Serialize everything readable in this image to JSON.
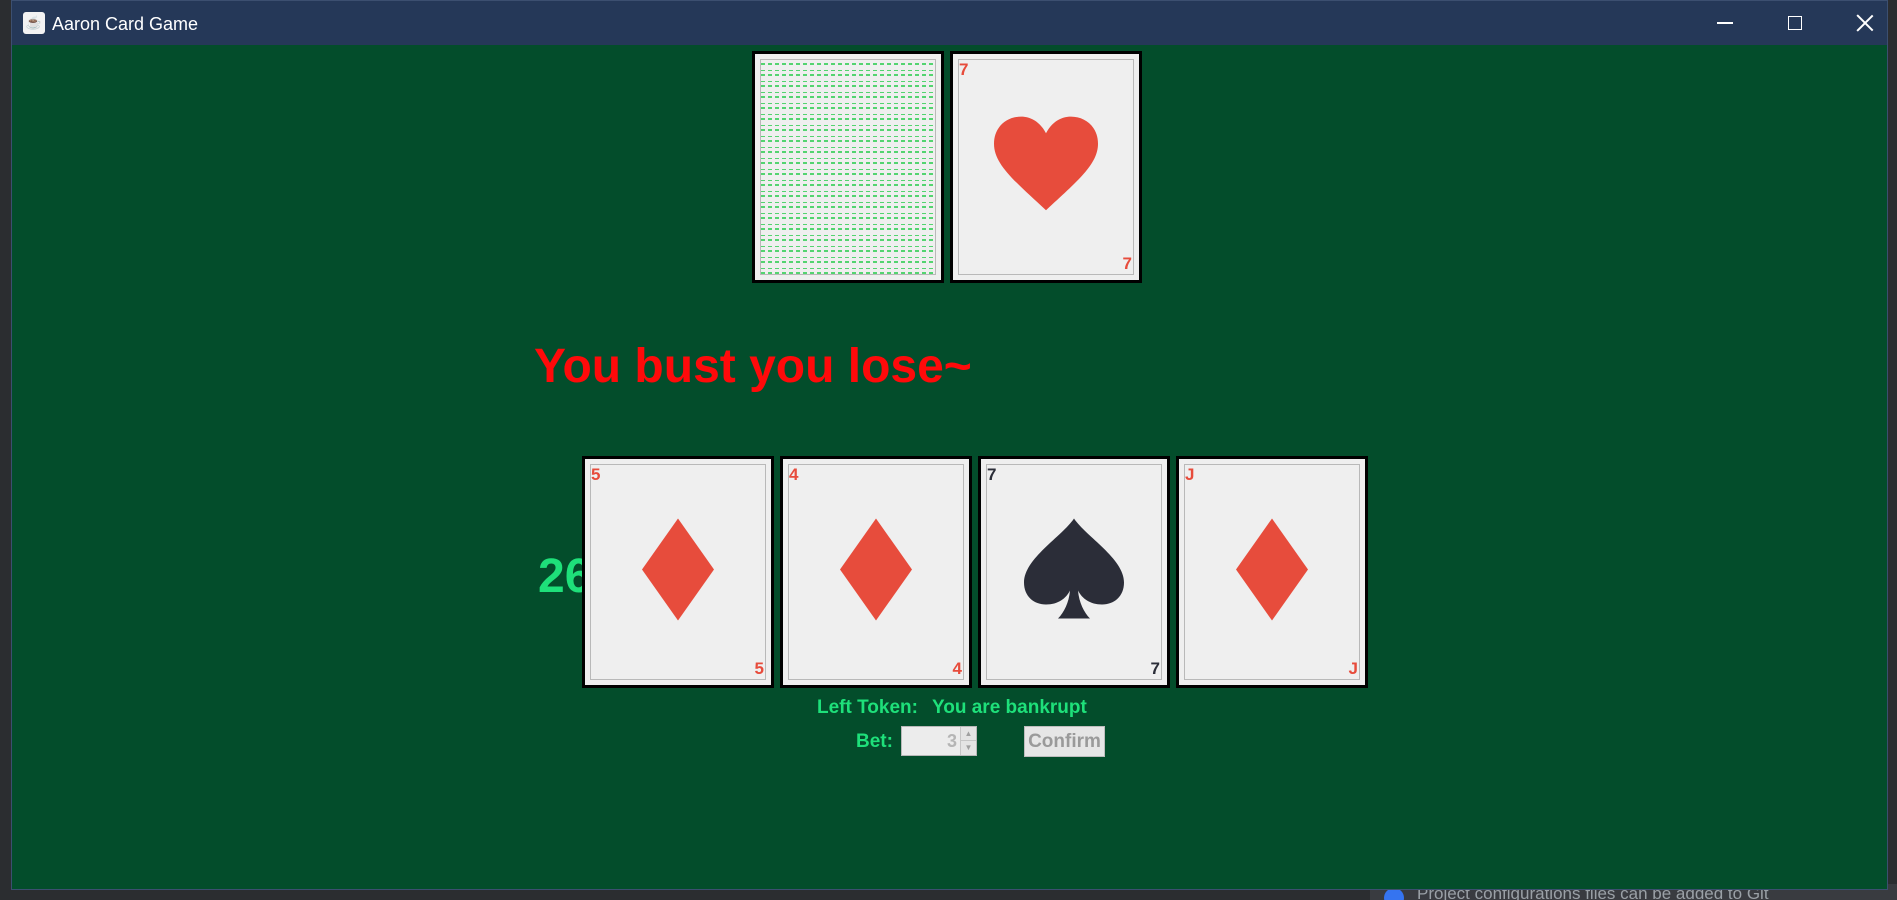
{
  "window": {
    "title": "Aaron Card Game",
    "background_color": "#034d2b",
    "titlebar_color": "#253858"
  },
  "dealer_hand": [
    {
      "face_down": true
    },
    {
      "face_down": false,
      "rank": "7",
      "suit": "heart",
      "color": "red"
    }
  ],
  "game": {
    "message": "You bust you lose~",
    "player_total": "26"
  },
  "player_hand": [
    {
      "rank": "5",
      "suit": "diamond",
      "color": "red"
    },
    {
      "rank": "4",
      "suit": "diamond",
      "color": "red"
    },
    {
      "rank": "7",
      "suit": "spade",
      "color": "black"
    },
    {
      "rank": "J",
      "suit": "diamond",
      "color": "red"
    }
  ],
  "controls": {
    "token_label": "Left Token:",
    "token_value": "You are bankrupt",
    "bet_label": "Bet:",
    "bet_value": "3",
    "confirm_label": "Confirm"
  },
  "background": {
    "ide_notification": "Project configurations files can be added to Git"
  },
  "colors": {
    "red_suit": "#e74c3c",
    "black_suit": "#2b2d38",
    "message": "#ff0a0a",
    "accent_green": "#1ee07a"
  }
}
